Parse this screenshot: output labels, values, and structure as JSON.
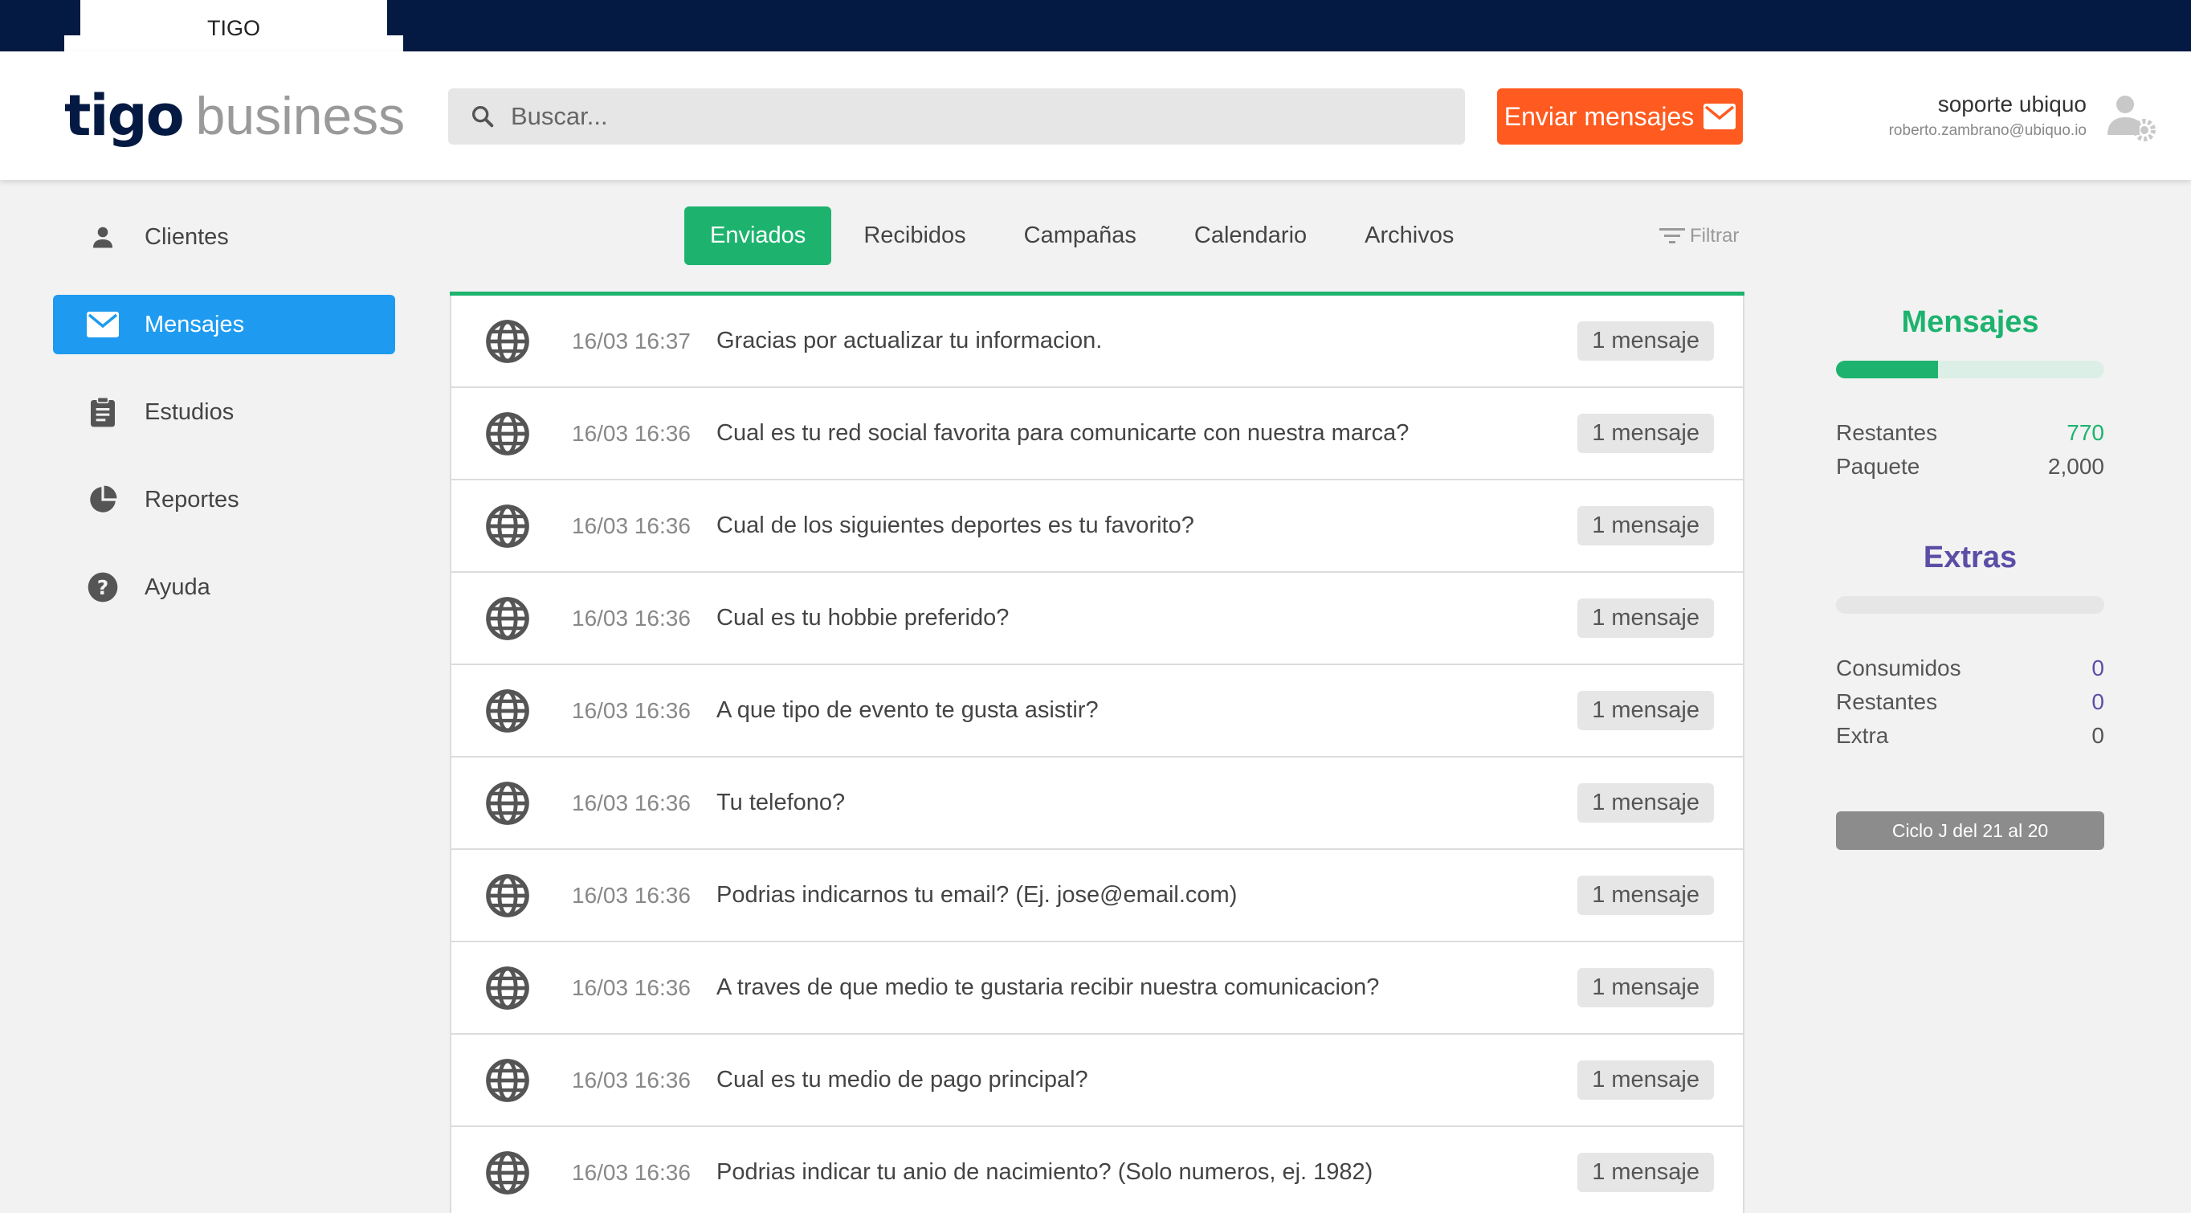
{
  "window": {
    "tab_label": "TIGO"
  },
  "header": {
    "logo_primary": "tigo",
    "logo_secondary": "business",
    "search_placeholder": "Buscar...",
    "send_button": "Enviar mensajes",
    "user_name": "soporte ubiquo",
    "user_email": "roberto.zambrano@ubiquo.io"
  },
  "sidebar": {
    "items": [
      {
        "label": "Clientes",
        "icon": "person-icon",
        "active": false
      },
      {
        "label": "Mensajes",
        "icon": "mail-icon",
        "active": true
      },
      {
        "label": "Estudios",
        "icon": "clipboard-icon",
        "active": false
      },
      {
        "label": "Reportes",
        "icon": "pie-chart-icon",
        "active": false
      },
      {
        "label": "Ayuda",
        "icon": "help-icon",
        "active": false
      }
    ]
  },
  "tabs": {
    "items": [
      {
        "label": "Enviados",
        "active": true
      },
      {
        "label": "Recibidos",
        "active": false
      },
      {
        "label": "Campañas",
        "active": false
      },
      {
        "label": "Calendario",
        "active": false
      },
      {
        "label": "Archivos",
        "active": false
      }
    ],
    "filter_label": "Filtrar"
  },
  "messages": [
    {
      "time": "16/03 16:37",
      "text": "Gracias por actualizar tu informacion.",
      "count": "1 mensaje"
    },
    {
      "time": "16/03 16:36",
      "text": "Cual es tu red social favorita para comunicarte con nuestra marca?",
      "count": "1 mensaje"
    },
    {
      "time": "16/03 16:36",
      "text": "Cual de los siguientes deportes es tu favorito?",
      "count": "1 mensaje"
    },
    {
      "time": "16/03 16:36",
      "text": "Cual es tu hobbie preferido?",
      "count": "1 mensaje"
    },
    {
      "time": "16/03 16:36",
      "text": "A que tipo de evento te gusta asistir?",
      "count": "1 mensaje"
    },
    {
      "time": "16/03 16:36",
      "text": "Tu telefono?",
      "count": "1 mensaje"
    },
    {
      "time": "16/03 16:36",
      "text": "Podrias indicarnos tu email? (Ej. jose@email.com)",
      "count": "1 mensaje"
    },
    {
      "time": "16/03 16:36",
      "text": "A traves de que medio te gustaria recibir nuestra comunicacion?",
      "count": "1 mensaje"
    },
    {
      "time": "16/03 16:36",
      "text": "Cual es tu medio de pago principal?",
      "count": "1 mensaje"
    },
    {
      "time": "16/03 16:36",
      "text": "Podrias indicar tu anio de nacimiento? (Solo numeros, ej. 1982)",
      "count": "1 mensaje"
    }
  ],
  "panel": {
    "mensajes_title": "Mensajes",
    "mensajes_usage_fraction": 0.38,
    "restantes_label": "Restantes",
    "restantes_value": "770",
    "paquete_label": "Paquete",
    "paquete_value": "2,000",
    "extras_title": "Extras",
    "consumidos_label": "Consumidos",
    "consumidos_value": "0",
    "extras_restantes_label": "Restantes",
    "extras_restantes_value": "0",
    "extra_label": "Extra",
    "extra_value": "0",
    "cycle_label": "Ciclo J del 21 al 20"
  },
  "colors": {
    "navy": "#041a42",
    "accent_blue": "#1e9bf0",
    "accent_green": "#1db36e",
    "accent_orange": "#ff5a1f",
    "extras_purple": "#5b4ea6"
  }
}
